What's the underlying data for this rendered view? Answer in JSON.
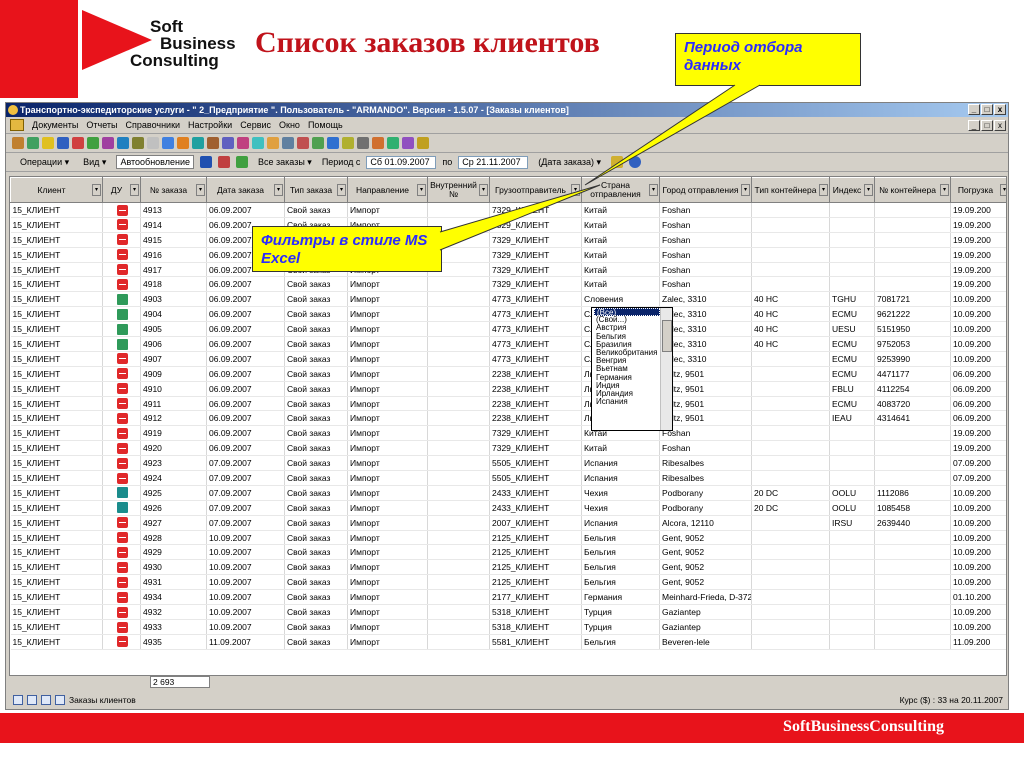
{
  "slide": {
    "title": "Список заказов клиентов",
    "logo_lines": [
      "Soft",
      "Business",
      "Consulting"
    ],
    "callout_period": "Период отбора данных",
    "callout_filter": "Фильтры в стиле MS Excel",
    "footer": "SoftBusinessConsulting"
  },
  "window": {
    "title": "Транспортно-экспедиторские услуги - \" 2_Предприятие \". Пользователь - \"ARMANDO\". Версия - 1.5.07 - [Заказы клиентов]",
    "menu": [
      "Документы",
      "Отчеты",
      "Справочники",
      "Настройки",
      "Сервис",
      "Окно",
      "Помощь"
    ],
    "buttons": [
      "_",
      "□",
      "x"
    ]
  },
  "toolbar2": {
    "operations": "Операции ▾",
    "view": "Вид ▾",
    "autoupdate": "Автообновление",
    "all_orders": "Все заказы ▾",
    "period_from_label": "Период с",
    "period_from": "Сб 01.09.2007",
    "to_label": "по",
    "period_to": "Ср 21.11.2007",
    "date_mode": "(Дата заказа) ▾"
  },
  "columns": [
    "Клиент",
    "ДУ",
    "№ заказа",
    "Дата заказа",
    "Тип заказа",
    "Направление",
    "Внутренний №",
    "Грузоотправитель",
    "Страна отправления",
    "Город отправления",
    "Тип контейнера",
    "Индекс",
    "№ контейнера",
    "Погрузка"
  ],
  "rows": [
    [
      "15_КЛИЕНТ",
      "r",
      "4913",
      "06.09.2007",
      "Свой заказ",
      "Импорт",
      "",
      "7329_КЛИЕНТ",
      "Китай",
      "Foshan",
      "",
      "",
      "",
      "19.09.200"
    ],
    [
      "15_КЛИЕНТ",
      "r",
      "4914",
      "06.09.2007",
      "Свой заказ",
      "Импорт",
      "",
      "7329_КЛИЕНТ",
      "Китай",
      "Foshan",
      "",
      "",
      "",
      "19.09.200"
    ],
    [
      "15_КЛИЕНТ",
      "r",
      "4915",
      "06.09.2007",
      "Свой заказ",
      "Импорт",
      "",
      "7329_КЛИЕНТ",
      "Китай",
      "Foshan",
      "",
      "",
      "",
      "19.09.200"
    ],
    [
      "15_КЛИЕНТ",
      "r",
      "4916",
      "06.09.2007",
      "Свой заказ",
      "Импорт",
      "",
      "7329_КЛИЕНТ",
      "Китай",
      "Foshan",
      "",
      "",
      "",
      "19.09.200"
    ],
    [
      "15_КЛИЕНТ",
      "r",
      "4917",
      "06.09.2007",
      "Свой заказ",
      "Импорт",
      "",
      "7329_КЛИЕНТ",
      "Китай",
      "Foshan",
      "",
      "",
      "",
      "19.09.200"
    ],
    [
      "15_КЛИЕНТ",
      "r",
      "4918",
      "06.09.2007",
      "Свой заказ",
      "Импорт",
      "",
      "7329_КЛИЕНТ",
      "Китай",
      "Foshan",
      "",
      "",
      "",
      "19.09.200"
    ],
    [
      "15_КЛИЕНТ",
      "g",
      "4903",
      "06.09.2007",
      "Свой заказ",
      "Импорт",
      "",
      "4773_КЛИЕНТ",
      "Словения",
      "Zalec, 3310",
      "40 HC",
      "TGHU",
      "7081721",
      "10.09.200"
    ],
    [
      "15_КЛИЕНТ",
      "g",
      "4904",
      "06.09.2007",
      "Свой заказ",
      "Импорт",
      "",
      "4773_КЛИЕНТ",
      "Словения",
      "Zalec, 3310",
      "40 HC",
      "ECMU",
      "9621222",
      "10.09.200"
    ],
    [
      "15_КЛИЕНТ",
      "g",
      "4905",
      "06.09.2007",
      "Свой заказ",
      "Импорт",
      "",
      "4773_КЛИЕНТ",
      "Словения",
      "Zalec, 3310",
      "40 HC",
      "UESU",
      "5151950",
      "10.09.200"
    ],
    [
      "15_КЛИЕНТ",
      "g",
      "4906",
      "06.09.2007",
      "Свой заказ",
      "Импорт",
      "",
      "4773_КЛИЕНТ",
      "Словения",
      "Zalec, 3310",
      "40 HC",
      "ECMU",
      "9752053",
      "10.09.200"
    ],
    [
      "15_КЛИЕНТ",
      "r",
      "4907",
      "06.09.2007",
      "Свой заказ",
      "Импорт",
      "",
      "4773_КЛИЕНТ",
      "Словения",
      "Zalec, 3310",
      "",
      "ECMU",
      "9253990",
      "10.09.200"
    ],
    [
      "15_КЛИЕНТ",
      "r",
      "4909",
      "06.09.2007",
      "Свой заказ",
      "Импорт",
      "",
      "2238_КЛИЕНТ",
      "Люксембург",
      "Wiltz, 9501",
      "",
      "ECMU",
      "4471177",
      "06.09.200"
    ],
    [
      "15_КЛИЕНТ",
      "r",
      "4910",
      "06.09.2007",
      "Свой заказ",
      "Импорт",
      "",
      "2238_КЛИЕНТ",
      "Люксембург",
      "Wiltz, 9501",
      "",
      "FBLU",
      "4112254",
      "06.09.200"
    ],
    [
      "15_КЛИЕНТ",
      "r",
      "4911",
      "06.09.2007",
      "Свой заказ",
      "Импорт",
      "",
      "2238_КЛИЕНТ",
      "Люксембург",
      "Wiltz, 9501",
      "",
      "ECMU",
      "4083720",
      "06.09.200"
    ],
    [
      "15_КЛИЕНТ",
      "r",
      "4912",
      "06.09.2007",
      "Свой заказ",
      "Импорт",
      "",
      "2238_КЛИЕНТ",
      "Люксембург",
      "Wiltz, 9501",
      "",
      "IEAU",
      "4314641",
      "06.09.200"
    ],
    [
      "15_КЛИЕНТ",
      "r",
      "4919",
      "06.09.2007",
      "Свой заказ",
      "Импорт",
      "",
      "7329_КЛИЕНТ",
      "Китай",
      "Foshan",
      "",
      "",
      "",
      "19.09.200"
    ],
    [
      "15_КЛИЕНТ",
      "r",
      "4920",
      "06.09.2007",
      "Свой заказ",
      "Импорт",
      "",
      "7329_КЛИЕНТ",
      "Китай",
      "Foshan",
      "",
      "",
      "",
      "19.09.200"
    ],
    [
      "15_КЛИЕНТ",
      "r",
      "4923",
      "07.09.2007",
      "Свой заказ",
      "Импорт",
      "",
      "5505_КЛИЕНТ",
      "Испания",
      "Ribesalbes",
      "",
      "",
      "",
      "07.09.200"
    ],
    [
      "15_КЛИЕНТ",
      "r",
      "4924",
      "07.09.2007",
      "Свой заказ",
      "Импорт",
      "",
      "5505_КЛИЕНТ",
      "Испания",
      "Ribesalbes",
      "",
      "",
      "",
      "07.09.200"
    ],
    [
      "15_КЛИЕНТ",
      "t",
      "4925",
      "07.09.2007",
      "Свой заказ",
      "Импорт",
      "",
      "2433_КЛИЕНТ",
      "Чехия",
      "Podborany",
      "20 DC",
      "OOLU",
      "1112086",
      "10.09.200"
    ],
    [
      "15_КЛИЕНТ",
      "t",
      "4926",
      "07.09.2007",
      "Свой заказ",
      "Импорт",
      "",
      "2433_КЛИЕНТ",
      "Чехия",
      "Podborany",
      "20 DC",
      "OOLU",
      "1085458",
      "10.09.200"
    ],
    [
      "15_КЛИЕНТ",
      "r",
      "4927",
      "07.09.2007",
      "Свой заказ",
      "Импорт",
      "",
      "2007_КЛИЕНТ",
      "Испания",
      "Alcora, 12110",
      "",
      "IRSU",
      "2639440",
      "10.09.200"
    ],
    [
      "15_КЛИЕНТ",
      "r",
      "4928",
      "10.09.2007",
      "Свой заказ",
      "Импорт",
      "",
      "2125_КЛИЕНТ",
      "Бельгия",
      "Gent, 9052",
      "",
      "",
      "",
      "10.09.200"
    ],
    [
      "15_КЛИЕНТ",
      "r",
      "4929",
      "10.09.2007",
      "Свой заказ",
      "Импорт",
      "",
      "2125_КЛИЕНТ",
      "Бельгия",
      "Gent, 9052",
      "",
      "",
      "",
      "10.09.200"
    ],
    [
      "15_КЛИЕНТ",
      "r",
      "4930",
      "10.09.2007",
      "Свой заказ",
      "Импорт",
      "",
      "2125_КЛИЕНТ",
      "Бельгия",
      "Gent, 9052",
      "",
      "",
      "",
      "10.09.200"
    ],
    [
      "15_КЛИЕНТ",
      "r",
      "4931",
      "10.09.2007",
      "Свой заказ",
      "Импорт",
      "",
      "2125_КЛИЕНТ",
      "Бельгия",
      "Gent, 9052",
      "",
      "",
      "",
      "10.09.200"
    ],
    [
      "15_КЛИЕНТ",
      "r",
      "4934",
      "10.09.2007",
      "Свой заказ",
      "Импорт",
      "",
      "2177_КЛИЕНТ",
      "Германия",
      "Meinhard-Frieda, D-372",
      "",
      "",
      "",
      "01.10.200"
    ],
    [
      "15_КЛИЕНТ",
      "r",
      "4932",
      "10.09.2007",
      "Свой заказ",
      "Импорт",
      "",
      "5318_КЛИЕНТ",
      "Турция",
      "Gaziantep",
      "",
      "",
      "",
      "10.09.200"
    ],
    [
      "15_КЛИЕНТ",
      "r",
      "4933",
      "10.09.2007",
      "Свой заказ",
      "Импорт",
      "",
      "5318_КЛИЕНТ",
      "Турция",
      "Gaziantep",
      "",
      "",
      "",
      "10.09.200"
    ],
    [
      "15_КЛИЕНТ",
      "r",
      "4935",
      "11.09.2007",
      "Свой заказ",
      "Импорт",
      "",
      "5581_КЛИЕНТ",
      "Бельгия",
      "Beveren-lele",
      "",
      "",
      "",
      "11.09.200"
    ]
  ],
  "dropdown": [
    "(Все)",
    "(Свой...)",
    "Австрия",
    "Бельгия",
    "Бразилия",
    "Великобритания",
    "Венгрия",
    "Вьетнам",
    "Германия",
    "Индия",
    "Ирландия",
    "Испания"
  ],
  "summary_count": "2 693",
  "status": {
    "tab": "Заказы клиентов",
    "rate": "Курс ($) : 33 на 20.11.2007"
  },
  "colors": {
    "brand_red": "#e8131b",
    "callout_yellow": "#ffff00",
    "callout_text": "#2b2bff"
  }
}
